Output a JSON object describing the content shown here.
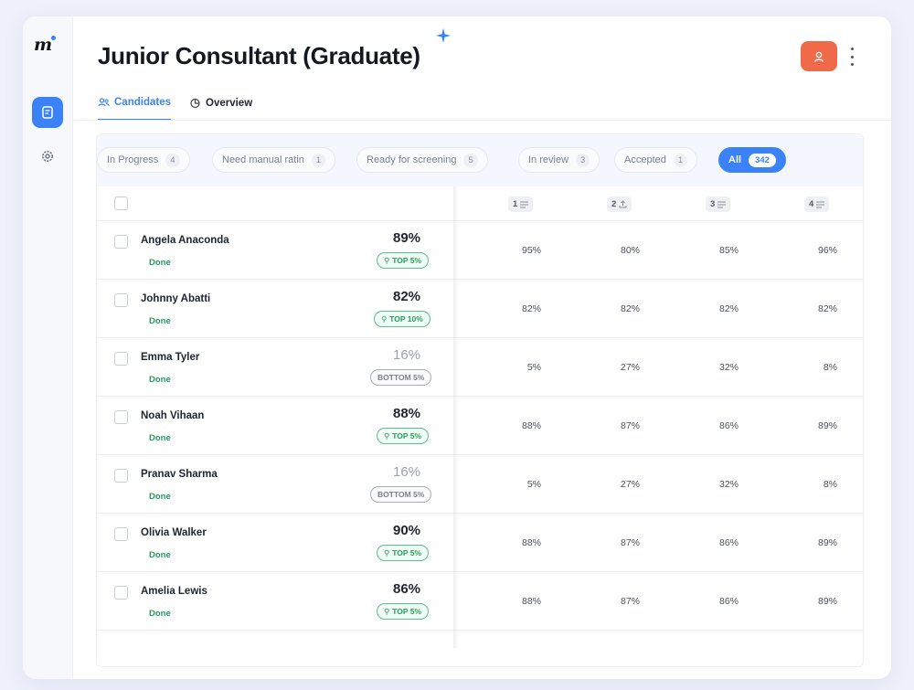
{
  "app": {
    "logo": "m",
    "accent": "#3b82f6",
    "avatar_color": "#f06a4a"
  },
  "header": {
    "title": "Junior Consultant (Graduate)"
  },
  "tabs": [
    {
      "label": "Candidates",
      "icon": "users-icon",
      "active": true
    },
    {
      "label": "Overview",
      "icon": "chart-icon",
      "active": false
    }
  ],
  "filters": [
    {
      "label": "In Progress",
      "count": "4"
    },
    {
      "label": "Need manual ratin",
      "count": "1"
    },
    {
      "label": "Ready for screening",
      "count": "5"
    },
    {
      "label": "In review",
      "count": "3"
    },
    {
      "label": "Accepted",
      "count": "1"
    },
    {
      "label": "All",
      "count": "342",
      "active": true
    }
  ],
  "columns": [
    {
      "label": "1",
      "icon": "list-icon"
    },
    {
      "label": "2",
      "icon": "upload-icon"
    },
    {
      "label": "3",
      "icon": "list-icon"
    },
    {
      "label": "4",
      "icon": "list-icon"
    }
  ],
  "candidates": [
    {
      "name": "Angela Anaconda",
      "status": "Done",
      "score": "89%",
      "badge": "TOP 5%",
      "badge_type": "top",
      "scores": [
        "95%",
        "80%",
        "85%",
        "96%"
      ]
    },
    {
      "name": "Johnny Abatti",
      "status": "Done",
      "score": "82%",
      "badge": "TOP 10%",
      "badge_type": "top",
      "scores": [
        "82%",
        "82%",
        "82%",
        "82%"
      ]
    },
    {
      "name": "Emma Tyler",
      "status": "Done",
      "score": "16%",
      "badge": "BOTTOM 5%",
      "badge_type": "bottom",
      "scores": [
        "5%",
        "27%",
        "32%",
        "8%"
      ]
    },
    {
      "name": "Noah Vihaan",
      "status": "Done",
      "score": "88%",
      "badge": "TOP 5%",
      "badge_type": "top",
      "scores": [
        "88%",
        "87%",
        "86%",
        "89%"
      ]
    },
    {
      "name": "Pranav Sharma",
      "status": "Done",
      "score": "16%",
      "badge": "BOTTOM 5%",
      "badge_type": "bottom",
      "scores": [
        "5%",
        "27%",
        "32%",
        "8%"
      ]
    },
    {
      "name": "Olivia Walker",
      "status": "Done",
      "score": "90%",
      "badge": "TOP 5%",
      "badge_type": "top",
      "scores": [
        "88%",
        "87%",
        "86%",
        "89%"
      ]
    },
    {
      "name": "Amelia Lewis",
      "status": "Done",
      "score": "86%",
      "badge": "TOP 5%",
      "badge_type": "top",
      "scores": [
        "88%",
        "87%",
        "86%",
        "89%"
      ]
    }
  ]
}
